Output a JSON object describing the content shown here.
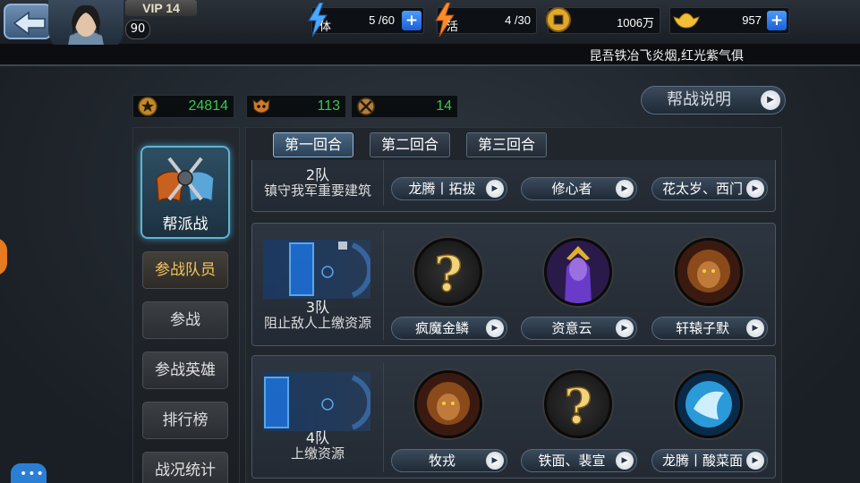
{
  "header": {
    "vip": "VIP 14",
    "level": "90",
    "resources": {
      "stamina": {
        "label": "体",
        "value": "5 /60"
      },
      "vitality": {
        "label": "活",
        "value": "4 /30"
      },
      "money": {
        "value": "1006万"
      },
      "gold": {
        "value": "957"
      }
    },
    "marquee": "昆吾铁冶飞炎烟,红光紫气俱"
  },
  "stats": [
    "24814",
    "113",
    "14"
  ],
  "info_button": "帮战说明",
  "sidebar": {
    "main_label": "帮派战",
    "items": [
      "参战队员",
      "参战",
      "参战英雄",
      "排行榜",
      "战况统计"
    ],
    "active_index": 0
  },
  "tabs": [
    "第一回合",
    "第二回合",
    "第三回合"
  ],
  "active_tab": 0,
  "teams": [
    {
      "name": "2队",
      "desc": "镇守我军重要建筑",
      "heroes": [
        "龙腾丨拓拔",
        "修心者",
        "花太岁、西门"
      ]
    },
    {
      "name": "3队",
      "desc": "阻止敌人上缴资源",
      "heroes": [
        "疯魔金鳞",
        "资意云",
        "轩辕子默"
      ]
    },
    {
      "name": "4队",
      "desc": "上缴资源",
      "heroes": [
        "牧戎",
        "铁面、裴宣",
        "龙腾丨酸菜面"
      ]
    }
  ],
  "icons": {
    "back": "back-arrow-icon",
    "stamina": "lightning-icon",
    "vitality": "lightning-icon",
    "money": "coin-icon",
    "gold": "gold-ingot-icon",
    "chat": "chat-icon"
  },
  "colors": {
    "stat_value": "#38c947",
    "plus_button": "#1c5fd6",
    "tab_active_border": "#8fb8dc",
    "sidebar_active": "#f2c55c"
  }
}
